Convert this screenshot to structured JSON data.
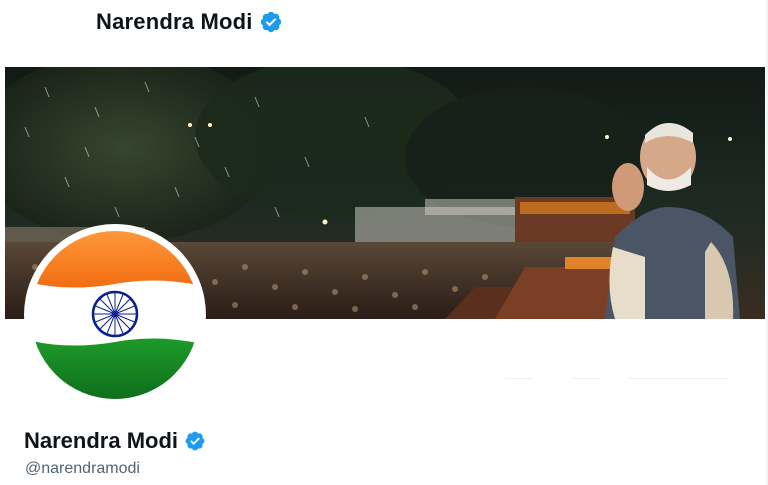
{
  "header": {
    "name": "Narendra Modi",
    "verified_icon": "verified-badge-icon",
    "verified_color": "#1d9bf0"
  },
  "banner": {
    "image_alt": "Banner photo: man with folded hands greeting a crowd at night in the rain"
  },
  "avatar": {
    "image_alt": "Indian national flag",
    "flag_colors": {
      "saffron": "#ff7f1f",
      "white": "#ffffff",
      "green": "#128807",
      "chakra": "#0b1f8f"
    }
  },
  "profile": {
    "name": "Narendra Modi",
    "handle": "@narendramodi"
  }
}
